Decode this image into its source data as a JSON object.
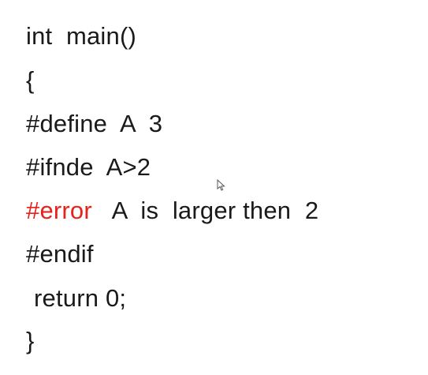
{
  "code": {
    "line1": "int  main()",
    "line2": "{",
    "line3": "#define  A  3",
    "line4": "#ifnde  A>2",
    "line5_directive": "#error",
    "line5_text": "   A  is  larger then  2",
    "line6": "#endif",
    "line7": "return 0;",
    "line8": "}"
  },
  "colors": {
    "error_directive": "#e8221b",
    "text": "#1a1a1a",
    "background": "#ffffff"
  },
  "icons": {
    "cursor": "mouse-pointer-icon"
  }
}
